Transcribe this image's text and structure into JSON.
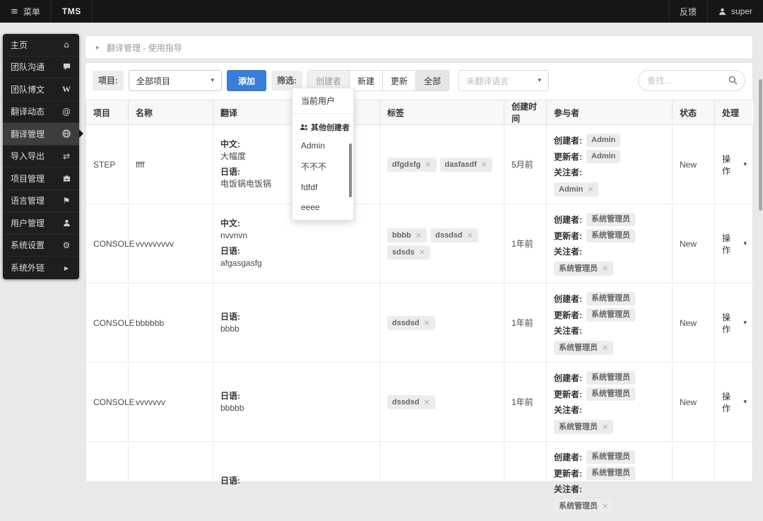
{
  "colors": {
    "accent_blue": "#3b7dd8",
    "navbar_bg": "#161616",
    "sidebar_bg": "#1e1e1e"
  },
  "navbar": {
    "menu_label": "菜单",
    "brand": "TMS",
    "feedback": "反馈",
    "user": "super"
  },
  "sidebar": {
    "items": [
      {
        "key": "home",
        "label": "主页",
        "icon": "home"
      },
      {
        "key": "team-chat",
        "label": "团队沟通",
        "icon": "comment"
      },
      {
        "key": "team-blog",
        "label": "团队博文",
        "icon": "wiki"
      },
      {
        "key": "translation-feed",
        "label": "翻译动态",
        "icon": "at"
      },
      {
        "key": "translation-manage",
        "label": "翻译管理",
        "icon": "globe",
        "active": true
      },
      {
        "key": "import-export",
        "label": "导入导出",
        "icon": "exchange"
      },
      {
        "key": "project-manage",
        "label": "项目管理",
        "icon": "briefcase"
      },
      {
        "key": "language-manage",
        "label": "语言管理",
        "icon": "flag"
      },
      {
        "key": "user-manage",
        "label": "用户管理",
        "icon": "user"
      },
      {
        "key": "system-settings",
        "label": "系统设置",
        "icon": "gears"
      },
      {
        "key": "external-links",
        "label": "系统外链",
        "icon": "caret-right"
      }
    ]
  },
  "breadcrumb": {
    "text": "翻译管理 - 使用指导"
  },
  "toolbar": {
    "project_label": "项目:",
    "project_select": "全部项目",
    "add_button": "添加",
    "filter_label": "筛选:",
    "filter_buttons": [
      {
        "key": "creator",
        "label": "创建者",
        "open": true
      },
      {
        "key": "new",
        "label": "新建"
      },
      {
        "key": "updated",
        "label": "更新"
      },
      {
        "key": "all",
        "label": "全部",
        "selected": true
      }
    ],
    "untranslated_placeholder": "未翻译语言",
    "search_placeholder": "查找..."
  },
  "creator_dropdown": {
    "current_user": "当前用户",
    "group_label": "其他创建者",
    "items": [
      "Admin",
      "不不不",
      "fdfdf",
      "eeee"
    ]
  },
  "table": {
    "headers": [
      "项目",
      "名称",
      "翻译",
      "标签",
      "创建时间",
      "参与者",
      "状态",
      "处理"
    ],
    "participant_labels": {
      "creator": "创建者:",
      "updater": "更新者:",
      "watcher": "关注者:"
    },
    "action_label": "操作",
    "rows": [
      {
        "project": "STEP",
        "name": "ffff",
        "translations": [
          {
            "lang": "中文:",
            "text": "大幅度"
          },
          {
            "lang": "日语:",
            "text": "电饭锅电饭锅"
          }
        ],
        "tags": [
          "dfgdsfg",
          "dasfasdf"
        ],
        "created": "5月前",
        "creator": "Admin",
        "updater": "Admin",
        "watchers": [
          "Admin"
        ],
        "status": "New"
      },
      {
        "project": "CONSOLE",
        "name": "vvvvvvvvv",
        "translations": [
          {
            "lang": "中文:",
            "text": "nvvnvn"
          },
          {
            "lang": "日语:",
            "text": "afgasgasfg"
          }
        ],
        "tags": [
          "bbbb",
          "dssdsd",
          "sdsds"
        ],
        "created": "1年前",
        "creator": "系统管理员",
        "updater": "系统管理员",
        "watchers": [
          "系统管理员"
        ],
        "status": "New"
      },
      {
        "project": "CONSOLE",
        "name": "bbbbbb",
        "translations": [
          {
            "lang": "日语:",
            "text": "bbbb"
          }
        ],
        "tags": [
          "dssdsd"
        ],
        "created": "1年前",
        "creator": "系统管理员",
        "updater": "系统管理员",
        "watchers": [
          "系统管理员"
        ],
        "status": "New"
      },
      {
        "project": "CONSOLE",
        "name": "vvvvvvv",
        "translations": [
          {
            "lang": "日语:",
            "text": "bbbbb"
          }
        ],
        "tags": [
          "dssdsd"
        ],
        "created": "1年前",
        "creator": "系统管理员",
        "updater": "系统管理员",
        "watchers": [
          "系统管理员"
        ],
        "status": "New"
      },
      {
        "project": "",
        "name": "",
        "translations": [
          {
            "lang": "日语:",
            "text": ""
          }
        ],
        "tags": [],
        "created": "",
        "creator": "系统管理员",
        "updater": "系统管理员",
        "watchers": [
          "系统管理员"
        ],
        "status": ""
      }
    ]
  }
}
